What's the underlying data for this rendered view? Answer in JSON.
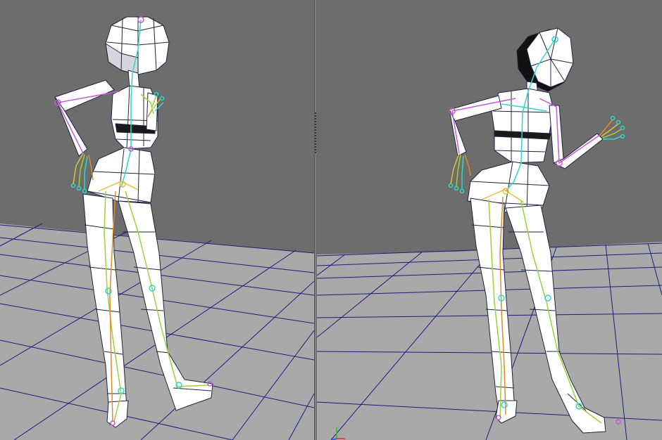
{
  "colors": {
    "background": "#6d6d6d",
    "floor": "#a9a9a9",
    "grid": "#1d1d7a",
    "mesh_fill": "#ffffff",
    "mesh_shade": "#d6d6dc",
    "mesh_edge": "#1e2340",
    "hair": "#111111",
    "bone_cyan": "#2fd7c8",
    "bone_green": "#9bd13a",
    "bone_orange": "#e38a2b",
    "bone_magenta": "#c25bd6",
    "bone_yellow": "#e0c23a",
    "axis_x": "#e03030",
    "axis_y": "#30c030",
    "axis_z": "#3050e0"
  },
  "viewports": {
    "left": {
      "name": "perspective-view-left",
      "character": "rigged-character-back-view"
    },
    "right": {
      "name": "perspective-view-right",
      "character": "rigged-character-front-view"
    }
  },
  "icons": {
    "axis": "xyz-axis-gizmo-icon",
    "divider": "viewport-splitter"
  }
}
